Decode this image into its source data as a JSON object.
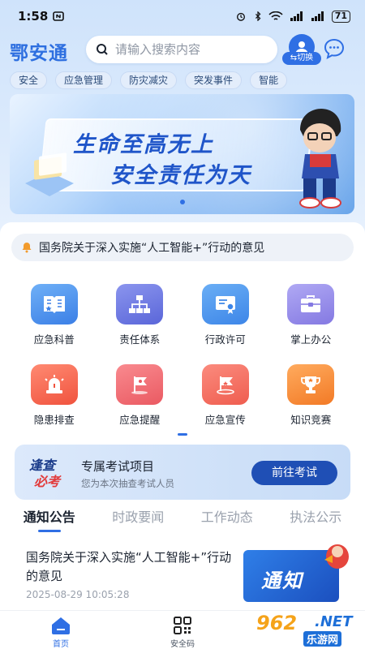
{
  "status_bar": {
    "time": "1:58",
    "battery": "71"
  },
  "header": {
    "app_title": "鄂安通",
    "search_placeholder": "请输入搜索内容",
    "switch_label": "切换"
  },
  "tags": [
    "安全",
    "应急管理",
    "防灾减灾",
    "突发事件",
    "智能"
  ],
  "banner": {
    "line1": "生命至高无上",
    "line2": "安全责任为天"
  },
  "notice": {
    "text": "国务院关于深入实施“人工智能+”行动的意见"
  },
  "grid": {
    "items": [
      {
        "label": "应急科普",
        "icon": "book-icon",
        "color": "#3b7fe6"
      },
      {
        "label": "责任体系",
        "icon": "hierarchy-icon",
        "color": "#5a66d9"
      },
      {
        "label": "行政许可",
        "icon": "certificate-icon",
        "color": "#3d86e8"
      },
      {
        "label": "掌上办公",
        "icon": "briefcase-icon",
        "color": "#8479e2"
      },
      {
        "label": "隐患排查",
        "icon": "alarm-icon",
        "color": "#f0533e"
      },
      {
        "label": "应急提醒",
        "icon": "flag-icon",
        "color": "#ea5a62"
      },
      {
        "label": "应急宣传",
        "icon": "flag-pin-icon",
        "color": "#ef5d4f"
      },
      {
        "label": "知识竞赛",
        "icon": "trophy-icon",
        "color": "#f27a26"
      }
    ]
  },
  "exam": {
    "logo_line1": "逢查",
    "logo_line2": "必考",
    "title": "专属考试项目",
    "subtitle": "您为本次抽查考试人员",
    "button": "前往考试"
  },
  "tabs": [
    "通知公告",
    "时政要闻",
    "工作动态",
    "执法公示"
  ],
  "active_tab": 0,
  "news": {
    "title": "国务院关于深入实施“人工智能+”行动的意见",
    "time": "2025-08-29 10:05:28",
    "thumb_text": "通知"
  },
  "bottom_nav": {
    "home": "首页",
    "safety_code": "安全码"
  },
  "watermark": {
    "num": "962",
    "net": ".NET",
    "cn": "乐游网"
  },
  "colors": {
    "brand": "#2f6fe4",
    "accent_dark": "#1f4fb5"
  }
}
